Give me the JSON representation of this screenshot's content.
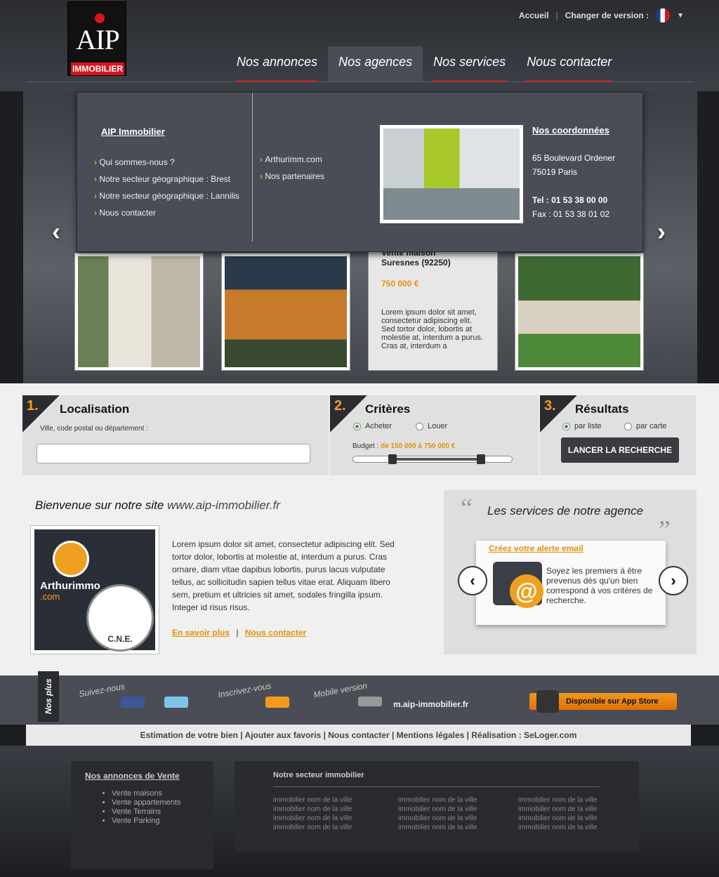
{
  "brand": {
    "logo_top": "AIP",
    "logo_bottom": "IMMOBILIER"
  },
  "toplinks": {
    "home": "Accueil",
    "separator": "|",
    "version": "Changer de version :"
  },
  "nav": [
    {
      "label": "Nos annonces"
    },
    {
      "label": "Nos agences"
    },
    {
      "label": "Nos services"
    },
    {
      "label": "Nous contacter"
    }
  ],
  "dropdown": {
    "title": "AIP Immobilier",
    "col1": [
      "Qui sommes-nous ?",
      "Notre secteur géographique : Brest",
      "Notre secteur géographique : Lannilis",
      "Nous contacter"
    ],
    "col2": [
      "Arthurimm.com",
      "Nos partenaires"
    ],
    "coords_title": "Nos coordonnées",
    "address1": "65 Boulevard Ordener",
    "address2": "75019 Paris",
    "tel": "Tel : 01 53 38 00 00",
    "fax": "Fax : 01 53 38 01 02"
  },
  "slider": {
    "prev": "‹",
    "next": "›",
    "card": {
      "title1": "Vente maison",
      "title2": "Suresnes (92250)",
      "price": "750 000 €",
      "desc": "Lorem ipsum dolor sit amet, consectetur adipiscing elit. Sed tortor dolor, lobortis at molestie at, interdum a purus. Cras at, interdum a"
    }
  },
  "search": {
    "step1": {
      "num": "1.",
      "title": "Localisation",
      "label": "Ville, code postal ou département :"
    },
    "step2": {
      "num": "2.",
      "title": "Critères",
      "buy": "Acheter",
      "rent": "Louer",
      "budget_label": "Budget :",
      "budget_value": "de 150 000 à 750 000 €"
    },
    "step3": {
      "num": "3.",
      "title": "Résultats",
      "list": "par liste",
      "map": "par carte",
      "button": "LANCER LA RECHERCHE"
    }
  },
  "welcome": {
    "title": "Bienvenue sur notre site",
    "url": "www.aip-immobilier.fr",
    "text": "Lorem ipsum dolor sit amet, consectetur adipiscing elit. Sed tortor dolor, lobortis at molestie at, interdum a purus. Cras ornare, diam vitae dapibus lobortis, purus lacus vulputate tellus, ac sollicitudin sapien tellus vitae erat. Aliquam libero sem, pretium et ultricies sit amet, sodales fringilla ipsum. Integer id risus risus.",
    "more": "En savoir plus",
    "sep": "|",
    "contact": "Nous contacter",
    "logo_name": "Arthurimmo",
    "logo_tld": ".com",
    "badge": "C.N.E."
  },
  "services": {
    "open_quote": "“",
    "close_quote": "„",
    "title": "Les services de notre agence",
    "link": "Créez votre alerte email",
    "text": "Soyez les premiers à être prevenus dès qu'un bien correspond à vos critères de recherche.",
    "icon_glyph": "@",
    "prev": "‹",
    "next": "›"
  },
  "social": {
    "tab": "Nos plus",
    "follow": "Suivez-nous",
    "subscribe": "Inscrivez-vous",
    "mobile": "Mobile version",
    "mobile_url": "m.aip-immobilier.fr",
    "appstore": "Disponible sur App Store",
    "apple_glyph": ""
  },
  "bottomlinks": "Estimation de votre bien | Ajouter aux favoris | Nous contacter | Mentions légales | Réalisation : SeLoger.com",
  "footer": {
    "sales_title": "Nos annonces de Vente",
    "sales": [
      "Vente maisons",
      "Vente appartements",
      "Vente Terrains",
      "Vente Parking"
    ],
    "sector_title": "Notre secteur immobilier",
    "sector_item": "immobilier nom de la ville"
  },
  "colors": {
    "accent": "#f0a020",
    "red": "#d9141e",
    "dark": "#2a2c31"
  }
}
